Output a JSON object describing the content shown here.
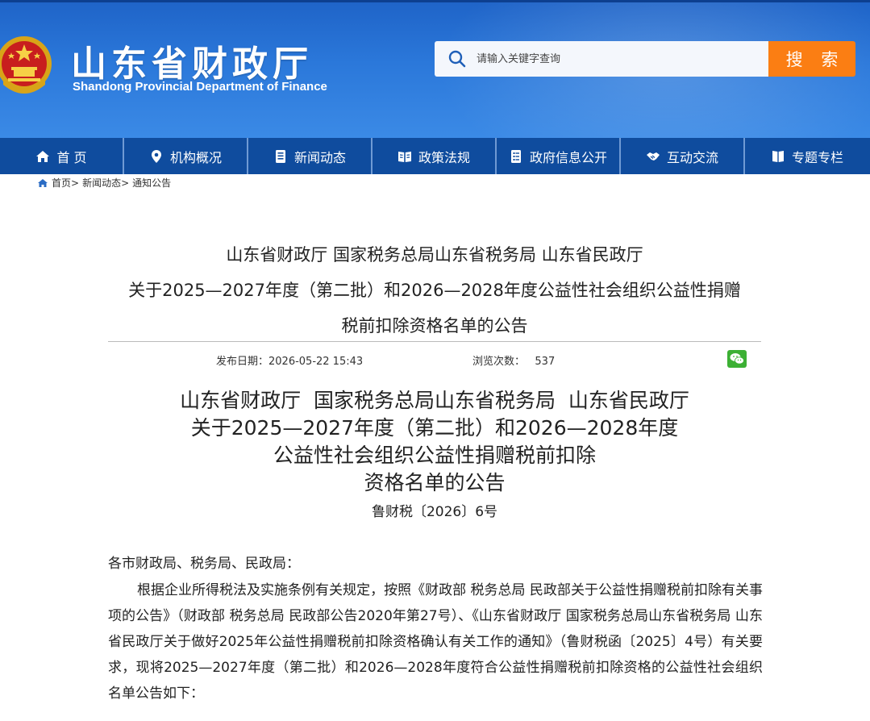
{
  "header": {
    "title": "山东省财政厅",
    "subtitle": "Shandong Provincial Department of Finance",
    "search_placeholder": "请输入关键字查询",
    "search_button": "搜 索"
  },
  "nav": {
    "items": [
      {
        "label": "首 页",
        "icon": "home-icon"
      },
      {
        "label": "机构概况",
        "icon": "location-pin-icon"
      },
      {
        "label": "新闻动态",
        "icon": "document-icon"
      },
      {
        "label": "政策法规",
        "icon": "open-book-icon"
      },
      {
        "label": "政府信息公开",
        "icon": "list-document-icon"
      },
      {
        "label": "互动交流",
        "icon": "handshake-icon"
      },
      {
        "label": "专题专栏",
        "icon": "book-icon"
      }
    ]
  },
  "breadcrumb": {
    "items": [
      "首页>",
      "新闻动态>",
      "通知公告"
    ]
  },
  "article": {
    "title_lines": [
      "山东省财政厅 国家税务总局山东省税务局 山东省民政厅",
      "关于2025—2027年度（第二批）和2026—2028年度公益性社会组织公益性捐赠",
      "税前扣除资格名单的公告"
    ],
    "publish_date_label": "发布日期：2026-05-22 15:43",
    "views_label": "浏览次数：   537",
    "doc_heading_lines": [
      "山东省财政厅  国家税务总局山东省税务局  山东省民政厅",
      "关于2025—2027年度（第二批）和2026—2028年度",
      "公益性社会组织公益性捐赠税前扣除",
      "资格名单的公告"
    ],
    "doc_number": "鲁财税〔2026〕6号",
    "salutation": "各市财政局、税务局、民政局：",
    "body": "根据企业所得税法及实施条例有关规定，按照《财政部 税务总局 民政部关于公益性捐赠税前扣除有关事项的公告》（财政部 税务总局 民政部公告2020年第27号）、《山东省财政厅 国家税务总局山东省税务局 山东省民政厅关于做好2025年公益性捐赠税前扣除资格确认有关工作的通知》（鲁财税函〔2025〕4号）有关要求，现将2025—2027年度（第二批）和2026—2028年度符合公益性捐赠税前扣除资格的公益性社会组织名单公告如下："
  },
  "colors": {
    "header_blue": "#2b78da",
    "nav_blue": "#0f4c9e",
    "search_orange": "#fb7e13",
    "wechat_green": "#3cb034"
  }
}
